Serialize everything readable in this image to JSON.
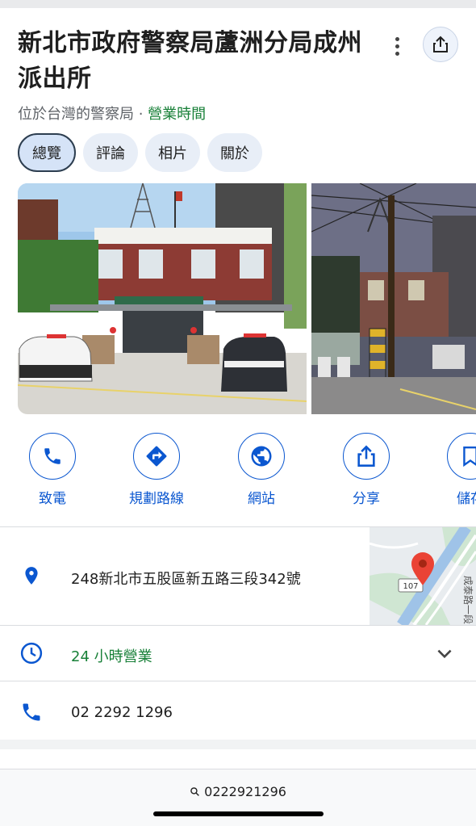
{
  "place": {
    "name": "新北市政府警察局蘆洲分局成州派出所",
    "category": "位於台灣的警察局",
    "separator": " · ",
    "hours_link": "營業時間"
  },
  "tabs": [
    {
      "label": "總覽"
    },
    {
      "label": "評論"
    },
    {
      "label": "相片"
    },
    {
      "label": "關於"
    }
  ],
  "actions": [
    {
      "label": "致電",
      "icon": "phone-icon"
    },
    {
      "label": "規劃路線",
      "icon": "directions-icon"
    },
    {
      "label": "網站",
      "icon": "globe-icon"
    },
    {
      "label": "分享",
      "icon": "share-icon"
    },
    {
      "label": "儲存",
      "icon": "bookmark-icon"
    }
  ],
  "details": {
    "address": "248新北市五股區新五路三段342號",
    "hours": "24 小時營業",
    "phone": "02 2292 1296"
  },
  "map": {
    "route_badge": "107",
    "road_label": "成泰路一段"
  },
  "bottom_bar": {
    "query": "0222921296"
  },
  "colors": {
    "accent": "#0b57d0",
    "open_green": "#188038",
    "pin_red": "#ea4335"
  }
}
